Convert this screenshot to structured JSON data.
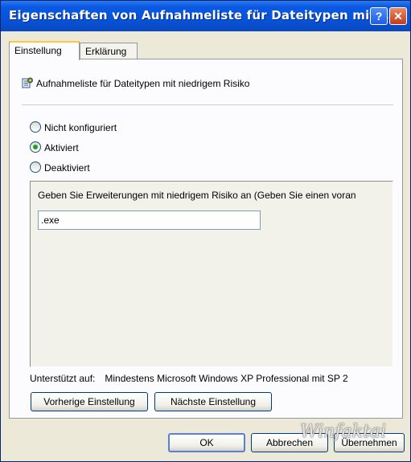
{
  "window": {
    "title": "Eigenschaften von Aufnahmeliste für Dateitypen mit ...",
    "help_glyph": "?",
    "close_glyph": "✕"
  },
  "tabs": [
    {
      "label": "Einstellung",
      "active": true
    },
    {
      "label": "Erklärung",
      "active": false
    }
  ],
  "policy": {
    "icon": "policy-settings-icon",
    "title": "Aufnahmeliste für Dateitypen mit niedrigem Risiko"
  },
  "options": {
    "not_configured": "Nicht konfiguriert",
    "enabled": "Aktiviert",
    "disabled": "Deaktiviert",
    "selected": "enabled"
  },
  "extensions": {
    "label": "Geben Sie Erweiterungen mit niedrigem Risiko an (Geben Sie einen voran",
    "value": ".exe"
  },
  "supported": {
    "label": "Unterstützt auf:",
    "value": "Mindestens Microsoft Windows XP Professional mit SP 2"
  },
  "buttons": {
    "previous": "Vorherige Einstellung",
    "next": "Nächste Einstellung",
    "ok": "OK",
    "cancel": "Abbrechen",
    "apply": "Übernehmen"
  },
  "watermark": "Winfaktai"
}
